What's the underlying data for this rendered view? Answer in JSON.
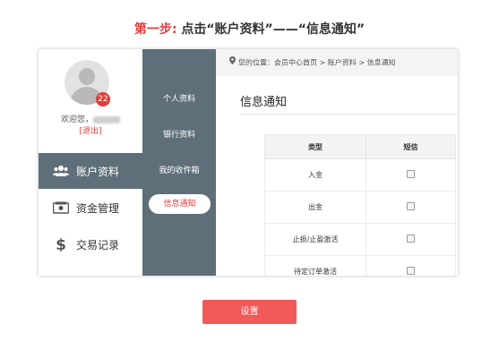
{
  "instruction": {
    "step": "第一步:",
    "text": " 点击“账户资料”——“信息通知”"
  },
  "user": {
    "badge": "22",
    "welcome": "欢迎您，",
    "logout": "[退出]"
  },
  "main_nav": [
    {
      "label": "账户资料",
      "icon": "users-icon",
      "active": true
    },
    {
      "label": "资金管理",
      "icon": "wallet-icon",
      "active": false
    },
    {
      "label": "交易记录",
      "icon": "dollar-icon",
      "active": false
    }
  ],
  "sub_nav": [
    {
      "label": "个人资料"
    },
    {
      "label": "银行资料"
    },
    {
      "label": "我的收件箱"
    },
    {
      "label": "信息通知",
      "active": true
    }
  ],
  "breadcrumb": "您的位置：会员中心首页 > 账户资料 > 信息通知",
  "panel_title": "信息通知",
  "table": {
    "headers": [
      "类型",
      "短信"
    ],
    "rows": [
      "入金",
      "出金",
      "止损/止盈激活",
      "待定订单激活"
    ]
  },
  "setup_button": "设置",
  "colors": {
    "accent_red": "#e43b3b",
    "nav_slate": "#5f6f7a",
    "button_red": "#f25a5a"
  }
}
